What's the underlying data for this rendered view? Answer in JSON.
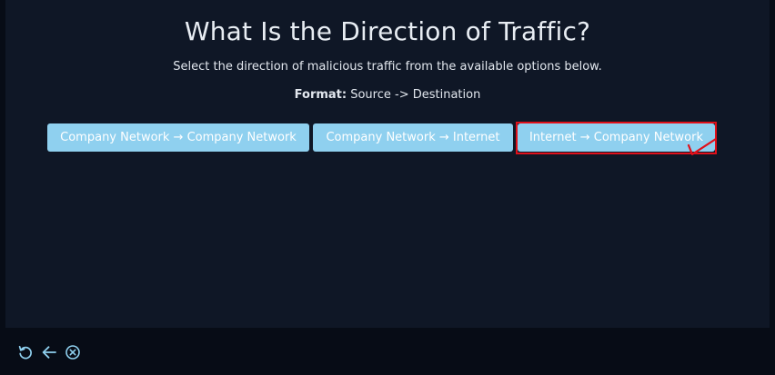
{
  "question": {
    "title": "What Is the Direction of Traffic?",
    "instruction": "Select the direction of malicious traffic from the available options below.",
    "format_label": "Format:",
    "format_value": " Source -> Destination"
  },
  "options": [
    {
      "label": "Company Network → Company Network"
    },
    {
      "label": "Company Network → Internet"
    },
    {
      "label": "Internet → Company Network"
    }
  ],
  "selected_option": "Internet → Company Network",
  "colors": {
    "background": "#070c16",
    "panel": "#0f1726",
    "option_button": "#8fd0ef",
    "highlight": "#e0101a",
    "icon": "#8fd0ef"
  },
  "footer": {
    "icons": [
      "restart-icon",
      "back-arrow-icon",
      "close-circle-icon"
    ]
  }
}
